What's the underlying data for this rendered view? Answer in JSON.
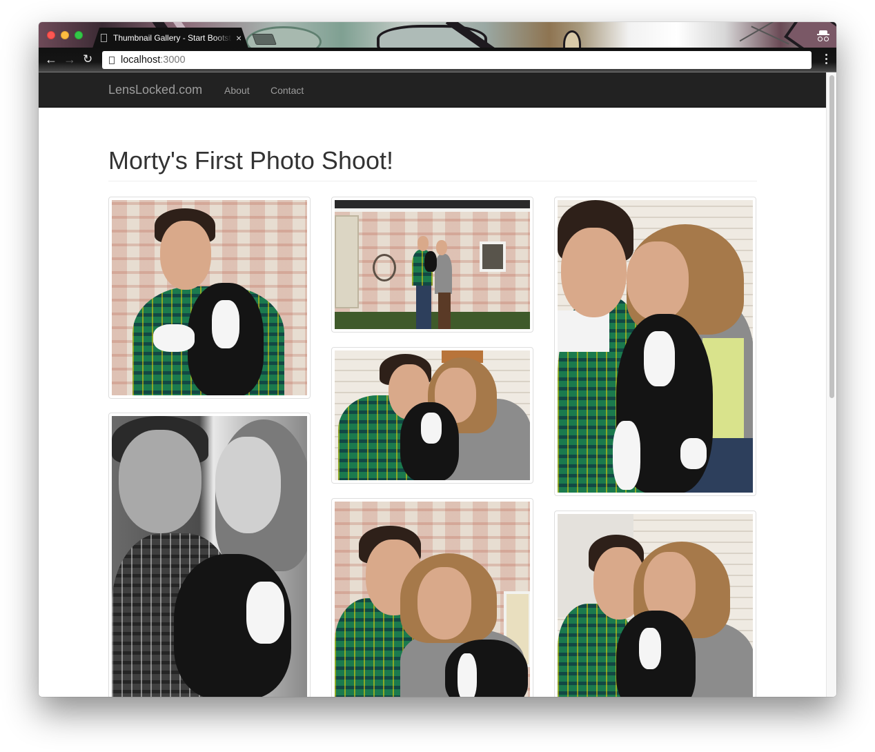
{
  "browser": {
    "tab": {
      "title": "Thumbnail Gallery - Start Bootstrap",
      "close_glyph": "×",
      "icon": "page-icon"
    },
    "toolbar": {
      "back_glyph": "←",
      "forward_glyph": "→",
      "reload_glyph": "↻",
      "url_host": "localhost",
      "url_port": ":3000"
    },
    "theme_colors": {
      "traffic_red": "#fc5753",
      "traffic_yellow": "#fdbc40",
      "traffic_green": "#33c748",
      "toolbar_bg": "#111111"
    },
    "incognito": true
  },
  "navbar": {
    "brand": "LensLocked.com",
    "links": [
      {
        "label": "About"
      },
      {
        "label": "Contact"
      }
    ],
    "bg_color": "#222222",
    "link_color": "#9d9d9d"
  },
  "page": {
    "title": "Morty's First Photo Shoot!",
    "gallery": {
      "columns": [
        {
          "images": [
            {
              "alt": "Man in green plaid shirt holding black and white puppy in front of brick wall",
              "orientation": "square"
            },
            {
              "alt": "Black and white photo of couple smiling at each other holding puppy",
              "orientation": "portrait"
            }
          ]
        },
        {
          "images": [
            {
              "alt": "Couple holding puppy standing in front of white brick barn",
              "orientation": "landscape"
            },
            {
              "alt": "Couple kissing puppy on front porch",
              "orientation": "landscape"
            },
            {
              "alt": "Couple smiling cheek to cheek with puppy in front of brick wall",
              "orientation": "square"
            }
          ]
        },
        {
          "images": [
            {
              "alt": "Couple touching foreheads while holding puppy",
              "orientation": "portrait"
            },
            {
              "alt": "Couple smiling with puppy in front of white siding",
              "orientation": "square"
            }
          ]
        }
      ]
    }
  }
}
